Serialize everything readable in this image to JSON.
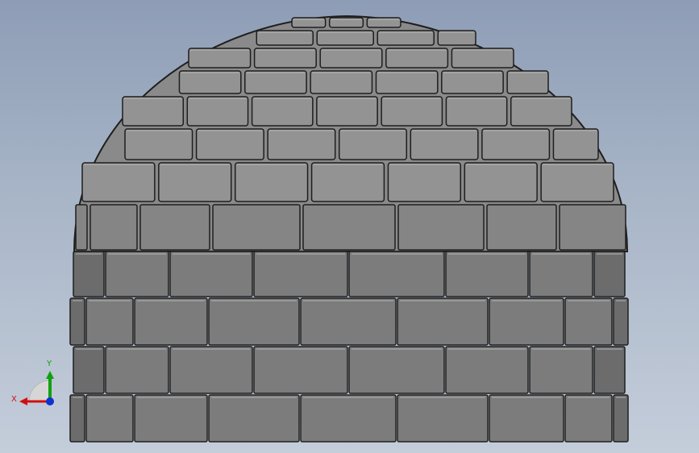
{
  "viewport": {
    "background_top": "#8e9db6",
    "background_bottom": "#c4cdda",
    "model": {
      "subject": "igloo",
      "brick_face": "#7c7c7c",
      "brick_edge": "#1e1e1e",
      "brick_highlight": "#b4b4b4",
      "dome_face": "#8a8a8a"
    },
    "triad": {
      "x_label": "X",
      "y_label": "Y",
      "x_color": "#d01010",
      "y_color": "#10a010",
      "z_color": "#1030d0",
      "icon": "coordinate-triad-icon"
    }
  }
}
